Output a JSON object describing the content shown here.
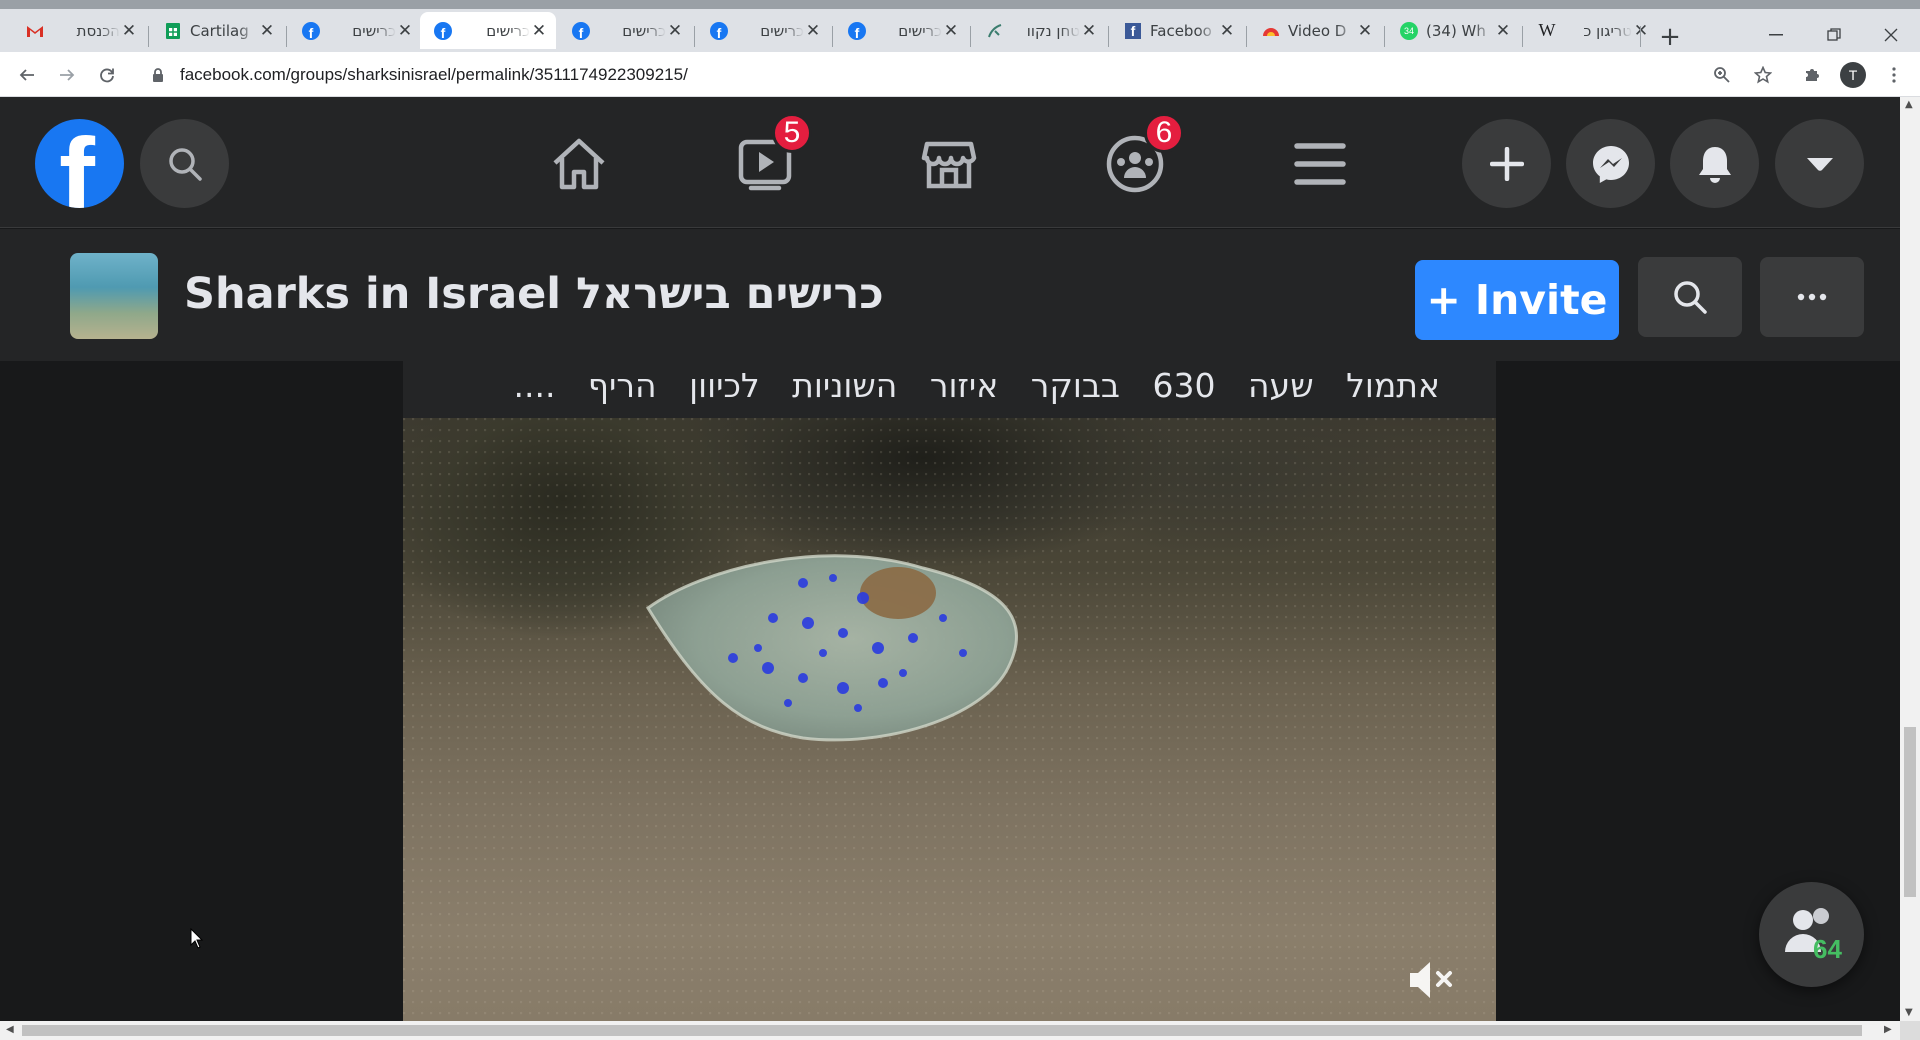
{
  "browser": {
    "tabs": [
      {
        "title": "הכנסת",
        "icon": "gmail-icon",
        "active": false
      },
      {
        "title": "Cartilag",
        "icon": "sheets-icon",
        "active": false
      },
      {
        "title": "כרישים",
        "icon": "facebook-icon",
        "active": false
      },
      {
        "title": "כרישים",
        "icon": "facebook-icon",
        "active": true
      },
      {
        "title": "כרישים",
        "icon": "facebook-icon",
        "active": false
      },
      {
        "title": "כרישים",
        "icon": "facebook-icon",
        "active": false
      },
      {
        "title": "כרישים",
        "icon": "facebook-icon",
        "active": false
      },
      {
        "title": "טחן נקוו",
        "icon": "app-icon",
        "active": false
      },
      {
        "title": "Faceboo",
        "icon": "facebook-square-icon",
        "active": false
      },
      {
        "title": "Video D",
        "icon": "video-downloader-icon",
        "active": false
      },
      {
        "title": "(34) Wh",
        "icon": "whatsapp-icon",
        "active": false
      },
      {
        "title": "טריגון כ",
        "icon": "wikipedia-icon",
        "active": false
      }
    ],
    "new_tab": "+",
    "url": "facebook.com/groups/sharksinisrael/permalink/3511174922309215/",
    "profile_initial": "T"
  },
  "facebook": {
    "logo": "f",
    "watch_badge": "5",
    "groups_badge": "6"
  },
  "group": {
    "name": "Sharks in Israel כרישים בישראל",
    "invite_label": "Invite",
    "invite_plus": "+"
  },
  "post": {
    "text": "אתמול שעה 630 בבוקר איזור השוניות לכיוון הריף ...."
  },
  "people_button": {
    "count": "64"
  },
  "colors": {
    "fb_blue": "#1877f2",
    "badge_red": "#e41e3f",
    "dark_surface": "#242526",
    "dark_bg": "#18191a"
  }
}
